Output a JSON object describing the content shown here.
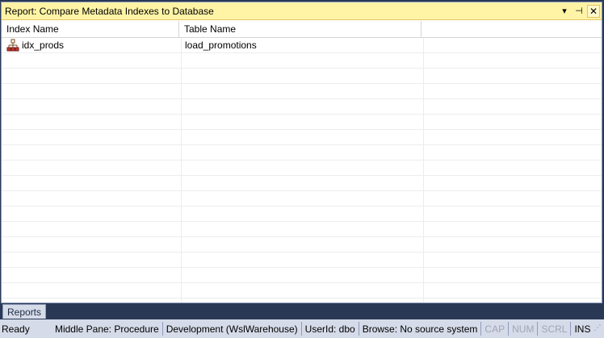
{
  "panel": {
    "title": "Report: Compare Metadata Indexes to Database",
    "buttons": {
      "dropdown": "▾",
      "pin": "⊣",
      "close": "✕"
    }
  },
  "grid": {
    "columns": [
      "Index Name",
      "Table Name",
      ""
    ],
    "rows": [
      {
        "index_name": "idx_prods",
        "table_name": "load_promotions",
        "icon": "index-icon"
      }
    ]
  },
  "tabs": {
    "reports": "Reports"
  },
  "status": {
    "ready": "Ready",
    "middle_pane": "Middle Pane: Procedure",
    "connection": "Development (WslWarehouse)",
    "userid": "UserId: dbo",
    "browse": "Browse: No source system",
    "cap": "CAP",
    "num": "NUM",
    "scrl": "SCRL",
    "ins": "INS"
  }
}
